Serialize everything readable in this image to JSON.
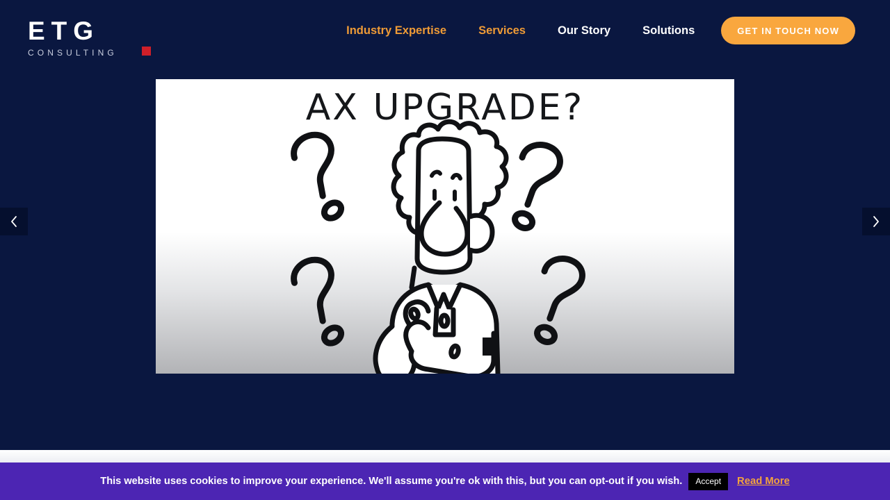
{
  "site": {
    "background_color": "#0a1740",
    "accent_color": "#f9a73e",
    "logo": {
      "primary_text": "ETG",
      "secondary_text": "CONSULTING",
      "dot_color": "#cf1f29"
    }
  },
  "nav": {
    "items": [
      {
        "label": "Industry Expertise",
        "style": "accent"
      },
      {
        "label": "Services",
        "style": "accent"
      },
      {
        "label": "Our Story",
        "style": "plain"
      },
      {
        "label": "Solutions",
        "style": "plain"
      }
    ],
    "cta_label": "GET IN TOUCH NOW"
  },
  "carousel": {
    "prev_icon": "chevron-left-icon",
    "next_icon": "chevron-right-icon",
    "slide": {
      "headline": "AX UPGRADE?",
      "alt": "Cartoon illustration of a puzzled man surrounded by question marks",
      "background": "white-to-gray-gradient"
    }
  },
  "cookie_banner": {
    "background_color": "#4c25b3",
    "message": "This website uses cookies to improve your experience. We'll assume you're ok with this, but you can opt-out if you wish.",
    "accept_label": "Accept",
    "read_more_label": "Read More"
  }
}
